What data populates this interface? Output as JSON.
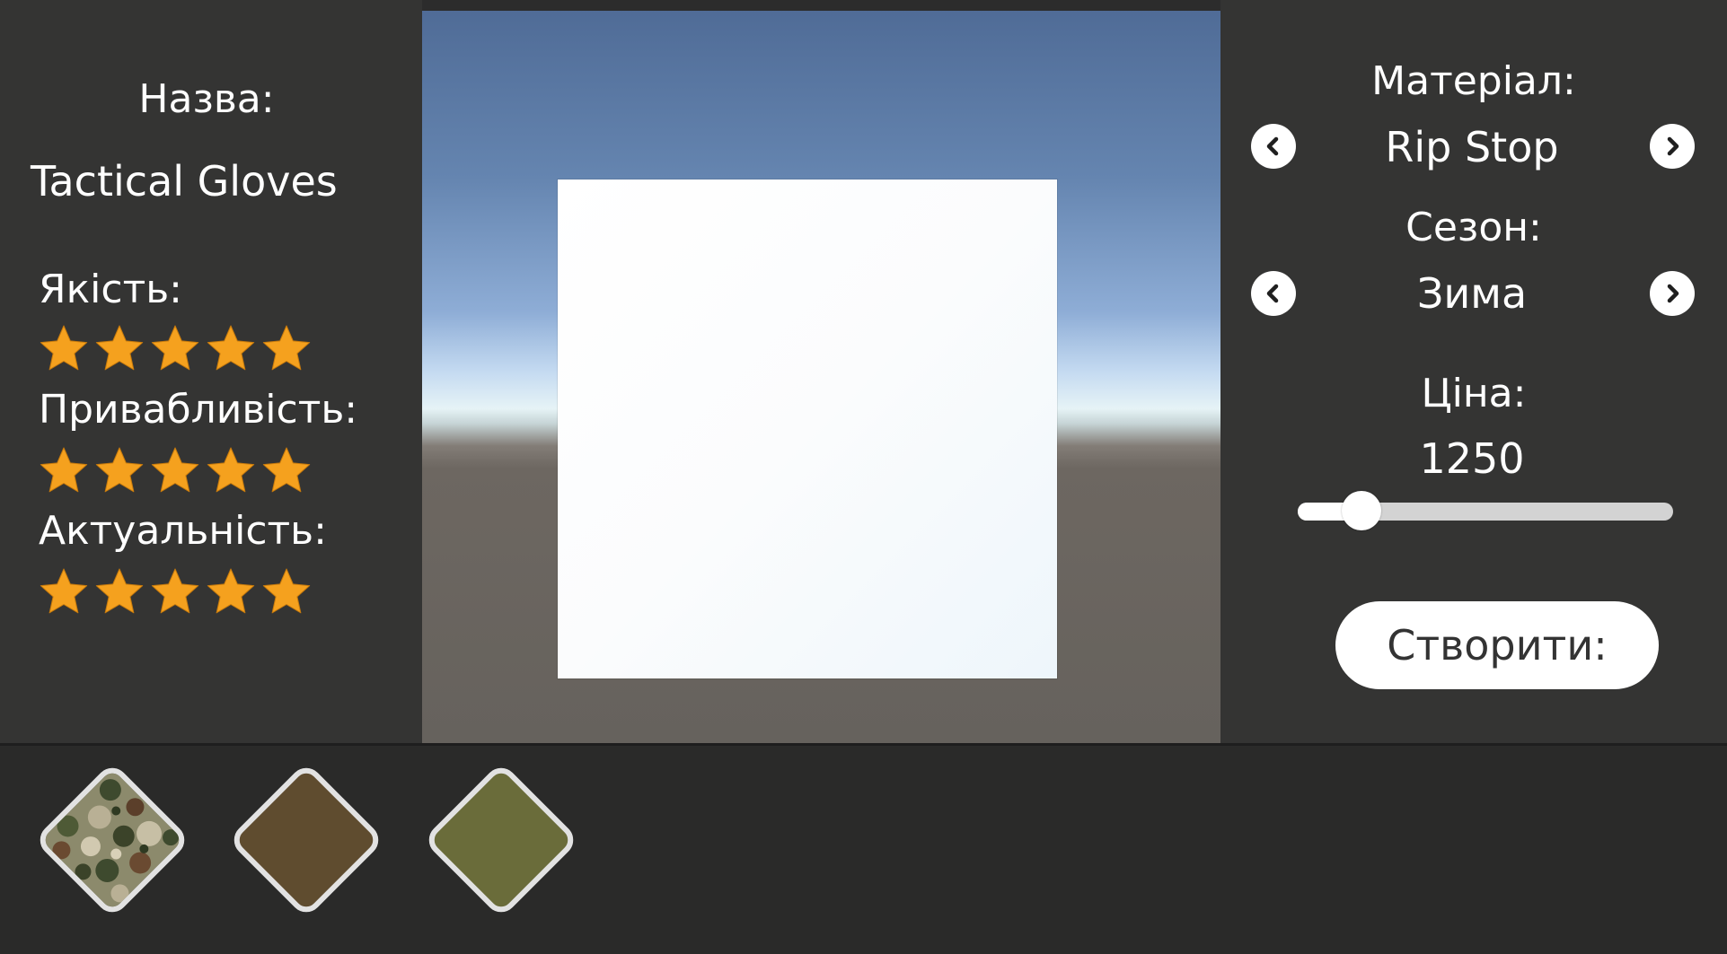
{
  "left_panel": {
    "name_label": "Назва:",
    "name_value": "Tactical Gloves",
    "ratings": [
      {
        "label": "Якість:",
        "stars": 5,
        "max": 5
      },
      {
        "label": "Привабливість:",
        "stars": 5,
        "max": 5
      },
      {
        "label": "Актуальність:",
        "stars": 5,
        "max": 5
      }
    ]
  },
  "right_panel": {
    "material_label": "Матеріал:",
    "material_value": "Rip Stop",
    "season_label": "Сезон:",
    "season_value": "Зима",
    "price_label": "Ціна:",
    "price_value": "1250",
    "price_slider_fraction": 0.17,
    "create_label": "Створити:",
    "prev_icon": "chevron-left-circle-icon",
    "next_icon": "chevron-right-circle-icon"
  },
  "bottom_bar": {
    "swatches": [
      {
        "name": "camouflage",
        "color": "#6b6a55"
      },
      {
        "name": "brown",
        "color": "#5f4c2f"
      },
      {
        "name": "olive",
        "color": "#6a6c3a"
      }
    ]
  },
  "colors": {
    "star": "#f5a11e",
    "panel": "#343433",
    "background": "#2a2a29"
  }
}
